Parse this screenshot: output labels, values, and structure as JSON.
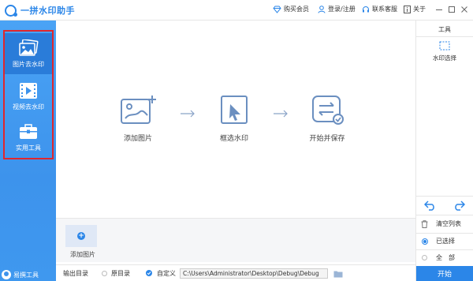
{
  "app": {
    "title": "一拼水印助手"
  },
  "header": {
    "vip": "购买会员",
    "login": "登录/注册",
    "support": "联系客服",
    "about": "关于"
  },
  "sidebar": {
    "items": [
      {
        "label": "图片去水印",
        "icon": "image-icon",
        "active": true
      },
      {
        "label": "视频去水印",
        "icon": "video-icon",
        "active": false
      },
      {
        "label": "实用工具",
        "icon": "toolbox-icon",
        "active": false
      }
    ],
    "footer": "易撰工具"
  },
  "steps": [
    {
      "label": "添加图片",
      "icon": "add-image-icon"
    },
    {
      "label": "框选水印",
      "icon": "select-area-icon"
    },
    {
      "label": "开始并保存",
      "icon": "convert-save-icon"
    }
  ],
  "tray": {
    "add_label": "添加图片"
  },
  "bottom": {
    "output_label": "输出目录",
    "original_label": "原目录",
    "custom_label": "自定义",
    "path": "C:\\Users\\Administrator\\Desktop\\Debug\\Debug"
  },
  "right_panel": {
    "title": "工具",
    "tool_label": "水印选择",
    "clear_label": "清空列表",
    "selected_label": "已选择",
    "all_label": "全　部",
    "start_label": "开始"
  },
  "colors": {
    "accent": "#2b86e8",
    "highlight": "#e0272d",
    "sidebar": "#3d93ec"
  }
}
